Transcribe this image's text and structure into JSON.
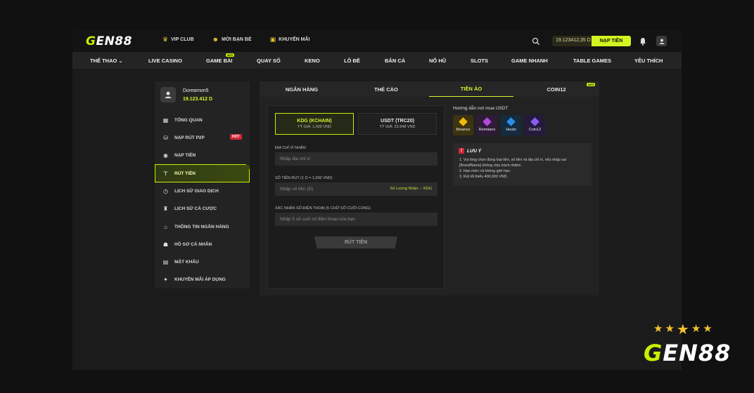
{
  "logo": {
    "g": "G",
    "rest": "EN88"
  },
  "toplinks": [
    {
      "label": "VIP CLUB",
      "icon": "crown-icon"
    },
    {
      "label": "MỜI BẠN BÈ",
      "icon": "friends-icon"
    },
    {
      "label": "KHUYẾN MÃI",
      "icon": "gift-icon"
    }
  ],
  "account": {
    "balance": "19.123412,35 D",
    "deposit_label": "NẠP TIỀN"
  },
  "nav": [
    {
      "label": "THỂ THAO ⌄"
    },
    {
      "label": "LIVE CASINO"
    },
    {
      "label": "GAME BÀI",
      "badge": "MỚI"
    },
    {
      "label": "QUAY SỐ"
    },
    {
      "label": "KENO"
    },
    {
      "label": "LÔ ĐỀ"
    },
    {
      "label": "BẮN CÁ"
    },
    {
      "label": "NỔ HŨ"
    },
    {
      "label": "SLOTS"
    },
    {
      "label": "GAME NHANH"
    },
    {
      "label": "TABLE GAMES"
    },
    {
      "label": "YÊU THÍCH"
    }
  ],
  "user": {
    "name": "Doreamon5",
    "balance": "19.123.412 D"
  },
  "sidebar": [
    {
      "label": "TỔNG QUAN",
      "icon": "grid-icon"
    },
    {
      "label": "NẠP RÚT P2P",
      "icon": "coins-icon",
      "badge": "HOT"
    },
    {
      "label": "NẠP TIỀN",
      "icon": "deposit-icon"
    },
    {
      "label": "RÚT TIỀN",
      "icon": "withdraw-icon",
      "active": true
    },
    {
      "label": "LỊCH SỬ GIAO DỊCH",
      "icon": "history-icon"
    },
    {
      "label": "LỊCH SỬ CÁ CƯỢC",
      "icon": "bet-history-icon"
    },
    {
      "label": "THÔNG TIN NGÂN HÀNG",
      "icon": "bank-icon"
    },
    {
      "label": "HỒ SƠ CÁ NHÂN",
      "icon": "profile-icon"
    },
    {
      "label": "MẬT KHẨU",
      "icon": "lock-icon"
    },
    {
      "label": "KHUYẾN MÃI ÁP DỤNG",
      "icon": "promo-icon"
    }
  ],
  "tabs": [
    {
      "label": "NGÂN HÀNG"
    },
    {
      "label": "THẺ CÀO"
    },
    {
      "label": "TIỀN ẢO",
      "active": true
    },
    {
      "label": "COIN12",
      "badge": "MỚI"
    }
  ],
  "currencies": [
    {
      "title": "KDG (KCHAIN)",
      "rate": "TỶ GIÁ: 1,000 VND",
      "selected": true
    },
    {
      "title": "USDT (TRC20)",
      "rate": "TỶ GIÁ: 25.948 VND"
    }
  ],
  "form": {
    "wallet_label": "ĐỊA CHỈ VÍ NHẬN",
    "wallet_placeholder": "Nhập địa chỉ ví",
    "amount_label": "SỐ TIỀN RÚT (1 D = 1,000 VND)",
    "amount_placeholder": "Nhập số tiền (D)",
    "receive_text": "Số Lượng Nhận: -- KDG",
    "phone_label": "XÁC NHẬN SỐ ĐIỆN THOẠI (5 CHỮ SỐ CUỐI CÙNG)",
    "phone_placeholder": "Nhập 5 số cuối số điện thoại của bạn",
    "submit_label": "RÚT TIỀN"
  },
  "guide": {
    "title": "Hướng dẫn nơi mua USDT",
    "exchanges": [
      {
        "name": "Binance",
        "color": "#f0b90b",
        "bg": "#3d3310"
      },
      {
        "name": "Remitano",
        "color": "#b24bd8",
        "bg": "#2f1a38"
      },
      {
        "name": "Houbi",
        "color": "#2a8fe8",
        "bg": "#142b40"
      },
      {
        "name": "Coin12",
        "color": "#8a5cf0",
        "bg": "#241a3d"
      }
    ]
  },
  "note": {
    "title": "LƯU Ý",
    "lines": [
      "1. Vui lòng chọn đúng loại tiền, số tiền và địa chỉ ví, nếu nhập sai [BrandName] không chịu trách nhiệm.",
      "2. Hạn mức rút không giới hạn.",
      "3. Rút tối thiểu 400,000 VND."
    ]
  },
  "brand": {
    "g": "G",
    "rest": "EN88"
  }
}
